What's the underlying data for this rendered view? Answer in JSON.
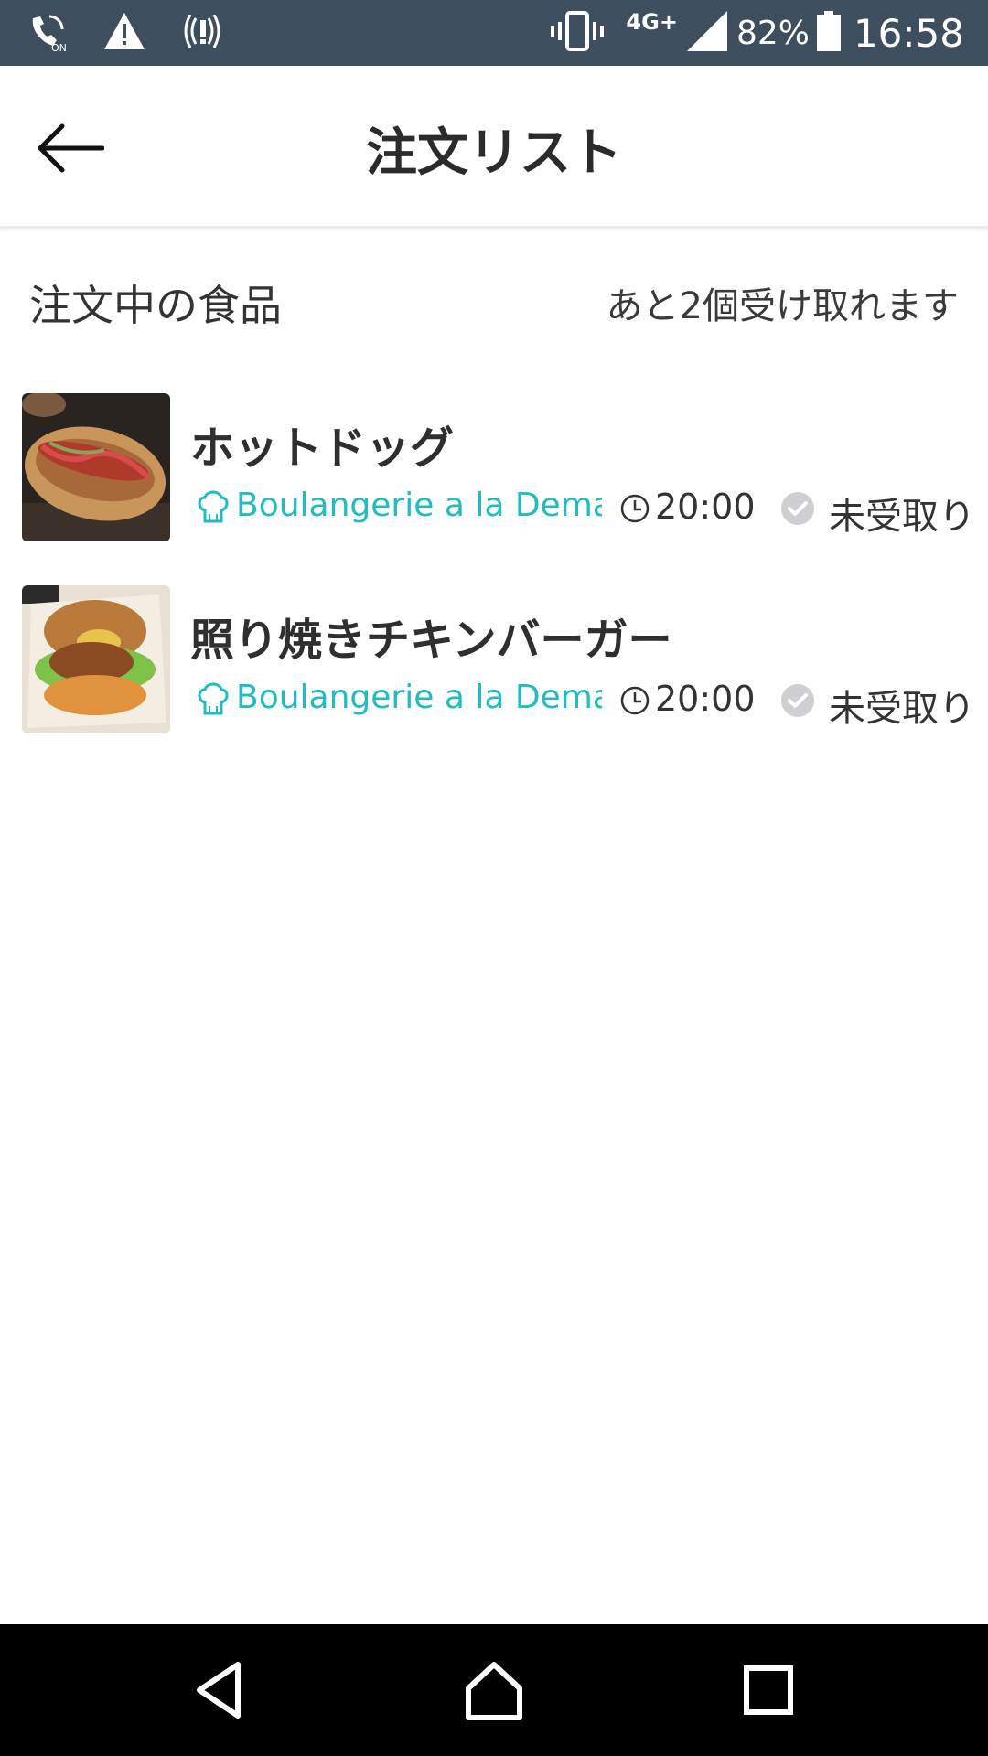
{
  "status_bar": {
    "network": "4G+",
    "battery": "82%",
    "time": "16:58"
  },
  "header": {
    "title": "注文リスト"
  },
  "section": {
    "title": "注文中の食品",
    "remaining_note": "あと2個受け取れます"
  },
  "orders": [
    {
      "name": "ホットドッグ",
      "shop": "Boulangerie a la Dema...",
      "time": "20:00",
      "status": "未受取り"
    },
    {
      "name": "照り焼きチキンバーガー",
      "shop": "Boulangerie a la Dema...",
      "time": "20:00",
      "status": "未受取り"
    }
  ],
  "colors": {
    "status_bar_bg": "#3d4e5f",
    "accent_teal": "#22bcc0",
    "check_grey": "#cfcfd3"
  },
  "icons": {
    "back": "arrow-left-icon",
    "shop": "chef-hat-icon",
    "time": "clock-icon",
    "status": "check-circle-icon"
  }
}
